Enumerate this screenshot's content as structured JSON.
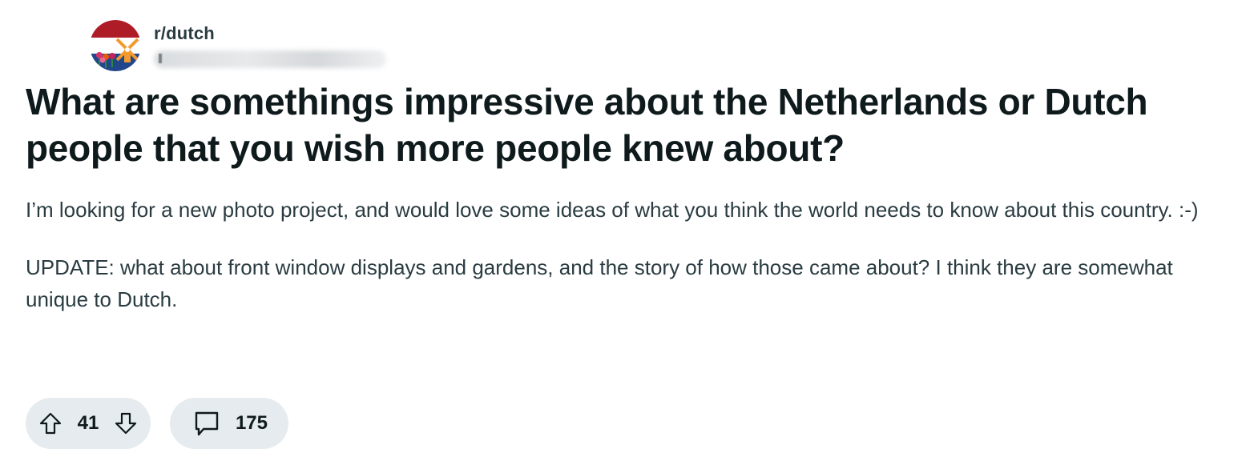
{
  "post": {
    "subreddit": "r/dutch",
    "title": "What are somethings impressive about the Netherlands or Dutch people that you wish more people knew about?",
    "body": [
      "I’m looking for a new photo project, and would love some ideas of what you think the world needs to know about this country. :-)",
      "UPDATE: what about front window displays and gardens, and the story of how those came about? I think they are somewhat unique to Dutch."
    ]
  },
  "actions": {
    "score": "41",
    "comments": "175"
  },
  "icons": {
    "upvote": "arrow-up-icon",
    "downvote": "arrow-down-icon",
    "comment": "speech-bubble-icon",
    "avatar": "dutch-flag-windmill-icon"
  },
  "colors": {
    "flag_red": "#ae1c28",
    "flag_white": "#ffffff",
    "flag_blue": "#21468b",
    "windmill_orange": "#f29a2e",
    "pill_bg": "#e5ebee",
    "text_primary": "#0f1a1c",
    "text_secondary": "#2a3c42"
  }
}
